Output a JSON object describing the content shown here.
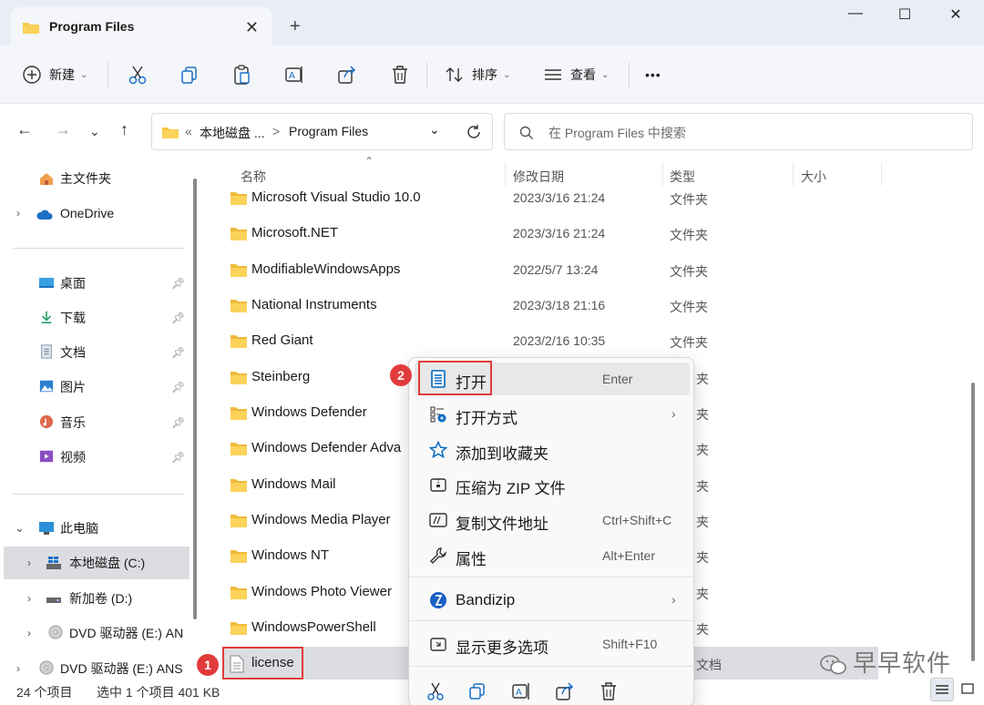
{
  "window": {
    "tab_title": "Program Files",
    "new_tab": "+",
    "close_tab": "✕",
    "minimize": "—",
    "maximize": "☐",
    "close": "✕"
  },
  "toolbar": {
    "new_label": "新建",
    "sort_label": "排序",
    "view_label": "查看",
    "more_label": "•••"
  },
  "address": {
    "prefix": "«",
    "crumb1": "本地磁盘 ...",
    "separator": ">",
    "crumb2": "Program Files"
  },
  "search": {
    "placeholder": "在 Program Files 中搜索"
  },
  "sidebar": {
    "home": "主文件夹",
    "onedrive": "OneDrive",
    "quick": [
      {
        "label": "桌面"
      },
      {
        "label": "下载"
      },
      {
        "label": "文档"
      },
      {
        "label": "图片"
      },
      {
        "label": "音乐"
      },
      {
        "label": "视频"
      }
    ],
    "thispc": "此电脑",
    "drives": [
      {
        "label": "本地磁盘 (C:)"
      },
      {
        "label": "新加卷 (D:)"
      },
      {
        "label": "DVD 驱动器 (E:) AN"
      },
      {
        "label": "DVD 驱动器 (E:) ANS"
      }
    ]
  },
  "columns": {
    "name": "名称",
    "date": "修改日期",
    "type": "类型",
    "size": "大小"
  },
  "files": [
    {
      "name": "Microsoft Visual Studio 10.0",
      "date": "2023/3/16 21:24",
      "type": "文件夹"
    },
    {
      "name": "Microsoft.NET",
      "date": "2023/3/16 21:24",
      "type": "文件夹"
    },
    {
      "name": "ModifiableWindowsApps",
      "date": "2022/5/7 13:24",
      "type": "文件夹"
    },
    {
      "name": "National Instruments",
      "date": "2023/3/18 21:16",
      "type": "文件夹"
    },
    {
      "name": "Red Giant",
      "date": "2023/2/16 10:35",
      "type": "文件夹"
    },
    {
      "name": "Steinberg",
      "date": "",
      "type": "夹"
    },
    {
      "name": "Windows Defender",
      "date": "",
      "type": "夹"
    },
    {
      "name": "Windows Defender Adva",
      "date": "",
      "type": "夹"
    },
    {
      "name": "Windows Mail",
      "date": "",
      "type": "夹"
    },
    {
      "name": "Windows Media Player",
      "date": "",
      "type": "夹"
    },
    {
      "name": "Windows NT",
      "date": "",
      "type": "夹"
    },
    {
      "name": "Windows Photo Viewer",
      "date": "",
      "type": "夹"
    },
    {
      "name": "WindowsPowerShell",
      "date": "",
      "type": "夹"
    },
    {
      "name": "license",
      "date": "",
      "type": "文档"
    }
  ],
  "context_menu": {
    "items": [
      {
        "label": "打开",
        "shortcut": "Enter"
      },
      {
        "label": "打开方式",
        "shortcut": ""
      },
      {
        "label": "添加到收藏夹",
        "shortcut": ""
      },
      {
        "label": "压缩为 ZIP 文件",
        "shortcut": ""
      },
      {
        "label": "复制文件地址",
        "shortcut": "Ctrl+Shift+C"
      },
      {
        "label": "属性",
        "shortcut": "Alt+Enter"
      },
      {
        "label": "Bandizip",
        "shortcut": ""
      },
      {
        "label": "显示更多选项",
        "shortcut": "Shift+F10"
      }
    ]
  },
  "annotations": {
    "badge1": "1",
    "badge2": "2"
  },
  "status": {
    "count": "24 个项目",
    "selected": "选中 1 个项目  401 KB"
  },
  "watermark": "早早软件",
  "colors": {
    "accent": "#0067c0",
    "folder": "#f7c744",
    "highlight": "#e23b3b"
  }
}
